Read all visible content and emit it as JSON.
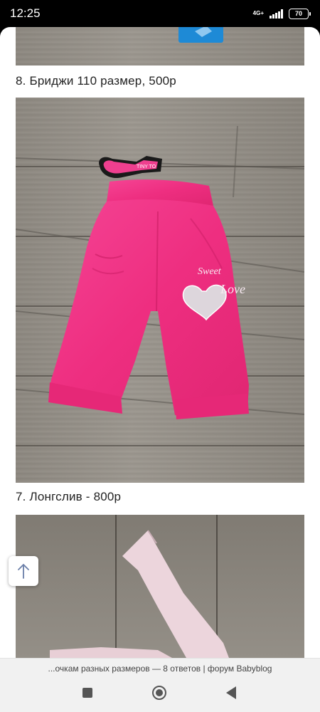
{
  "status_bar": {
    "time": "12:25",
    "network": "4G+",
    "battery": "70"
  },
  "content": {
    "captions": [
      "8. Бриджи 110 размер, 500р",
      "7. Лонгслив - 800р"
    ],
    "photos": [
      {
        "name": "wooden-floor-photo-top"
      },
      {
        "name": "pink-capri-pants-photo",
        "tag_text": "TINY TO"
      },
      {
        "name": "longsleeve-photo"
      }
    ]
  },
  "url_bar": {
    "text": "...очкам разных размеров — 8 ответов | форум Babyblog"
  },
  "colors": {
    "accent_pink": "#f0307e",
    "tag_blue": "#1e8ad6"
  }
}
